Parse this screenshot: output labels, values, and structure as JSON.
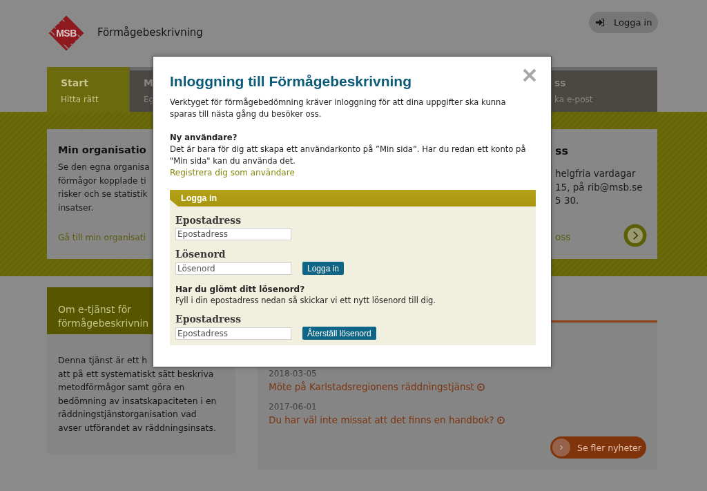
{
  "header": {
    "logo_text": "MSB",
    "site_title": "Förmågebeskrivning",
    "login_button": "Logga in"
  },
  "nav_tabs": [
    {
      "title": "Start",
      "subtitle": "Hitta rätt",
      "selected": true
    },
    {
      "title": "M",
      "subtitle": "Eg",
      "selected": false
    },
    {
      "title": "ss",
      "subtitle": "ka e-post",
      "selected": false
    }
  ],
  "feature_cards": [
    {
      "title": "Min organisatio",
      "lines": [
        "Se den egna organisa",
        "förmågor kopplade ti",
        "risker och se statistik",
        "insatser."
      ],
      "link": "Gå till min organisati"
    },
    {
      "title": "ss",
      "lines": [
        "helgfria vardagar",
        "15, på rib@msb.se",
        "5 30."
      ],
      "link": "oss"
    }
  ],
  "about_card": {
    "title_lines": [
      "Om e-tjänst för",
      "förmågebeskrivnin"
    ],
    "lines": [
      "Denna tjänst är ett h",
      "att på ett systematiskt sätt beskriva",
      "metodförmågor samt göra en",
      "bedömning av insatskapaciteten i en",
      "räddningstjänstorganisation vad",
      "avser utförandet av räddningsinsats."
    ]
  },
  "news": {
    "items": [
      {
        "date": "2018-03-05",
        "title": "Möte på Karlstadsregionens räddningstjänst"
      },
      {
        "date": "2017-06-01",
        "title": "Du har väl inte missat att det finns en handbok?"
      }
    ],
    "more_button": "Se fler nyheter"
  },
  "modal": {
    "title": "Inloggning till Förmågebeskrivning",
    "intro": "Verktyget för förmågebedömning kräver inloggning för att dina uppgifter ska kunna sparas till nästa gång du besöker oss.",
    "new_user_heading": "Ny användare?",
    "new_user_text": "Det är bara för dig att skapa ett användarkonto på ”Min sida”. Har du redan ett konto på \"Min sida\" kan du använda det.",
    "register_link": "Registrera dig som användare",
    "login_panel": {
      "header": "Logga in",
      "email_label": "Epostadress",
      "email_placeholder": "Epostadress",
      "password_label": "Lösenord",
      "password_placeholder": "Lösenord",
      "login_button": "Logga in",
      "forgot_heading": "Har du glömt ditt lösenord?",
      "forgot_text": "Fyll i din epostadress nedan så skickar vi ett nytt lösenord till dig.",
      "reset_email_label": "Epostadress",
      "reset_email_placeholder": "Epostadress",
      "reset_button": "Återställ lösenord"
    }
  }
}
